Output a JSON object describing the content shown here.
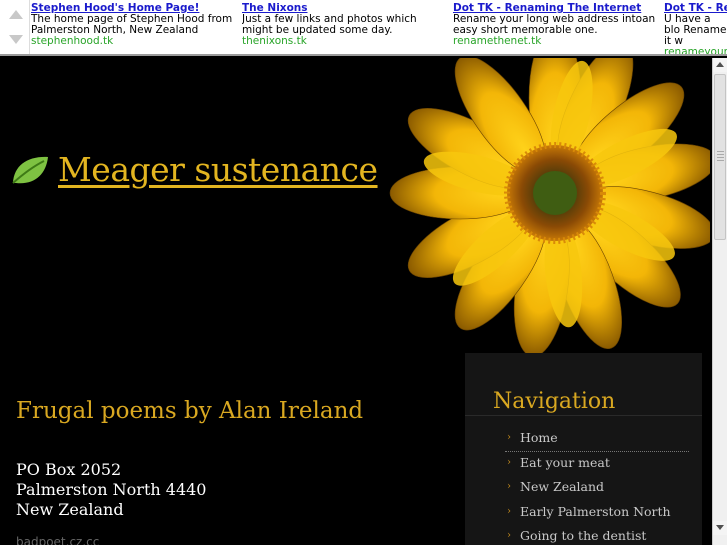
{
  "ads": [
    {
      "title": "Stephen Hood's Home Page!",
      "desc": "The home page of Stephen Hood from Palmerston North, New Zealand",
      "url": "stephenhood.tk"
    },
    {
      "title": "The Nixons",
      "desc": "Just a few links and photos which might be updated some day.",
      "url": "thenixons.tk"
    },
    {
      "title": "Dot TK - Renaming The Internet",
      "desc": "Rename your long web address intoan easy short memorable one.",
      "url": "renamethenet.tk"
    },
    {
      "title": "Dot TK - Re",
      "desc": "U have a blo Rename it w",
      "url": "renameyour"
    }
  ],
  "site": {
    "title": "Meager sustenance",
    "subtitle": "Frugal poems by Alan Ireland",
    "address": [
      "PO Box 2052",
      "Palmerston North 4440",
      "New Zealand"
    ],
    "footer_link": "badpoet.cz.cc"
  },
  "navigation": {
    "heading": "Navigation",
    "items": [
      "Home",
      "Eat your meat",
      "New Zealand",
      "Early Palmerston North",
      "Going to the dentist"
    ]
  },
  "colors": {
    "accent": "#d9a821",
    "background": "#000000",
    "ad_link": "#1a1acc",
    "ad_url": "#28a428"
  }
}
